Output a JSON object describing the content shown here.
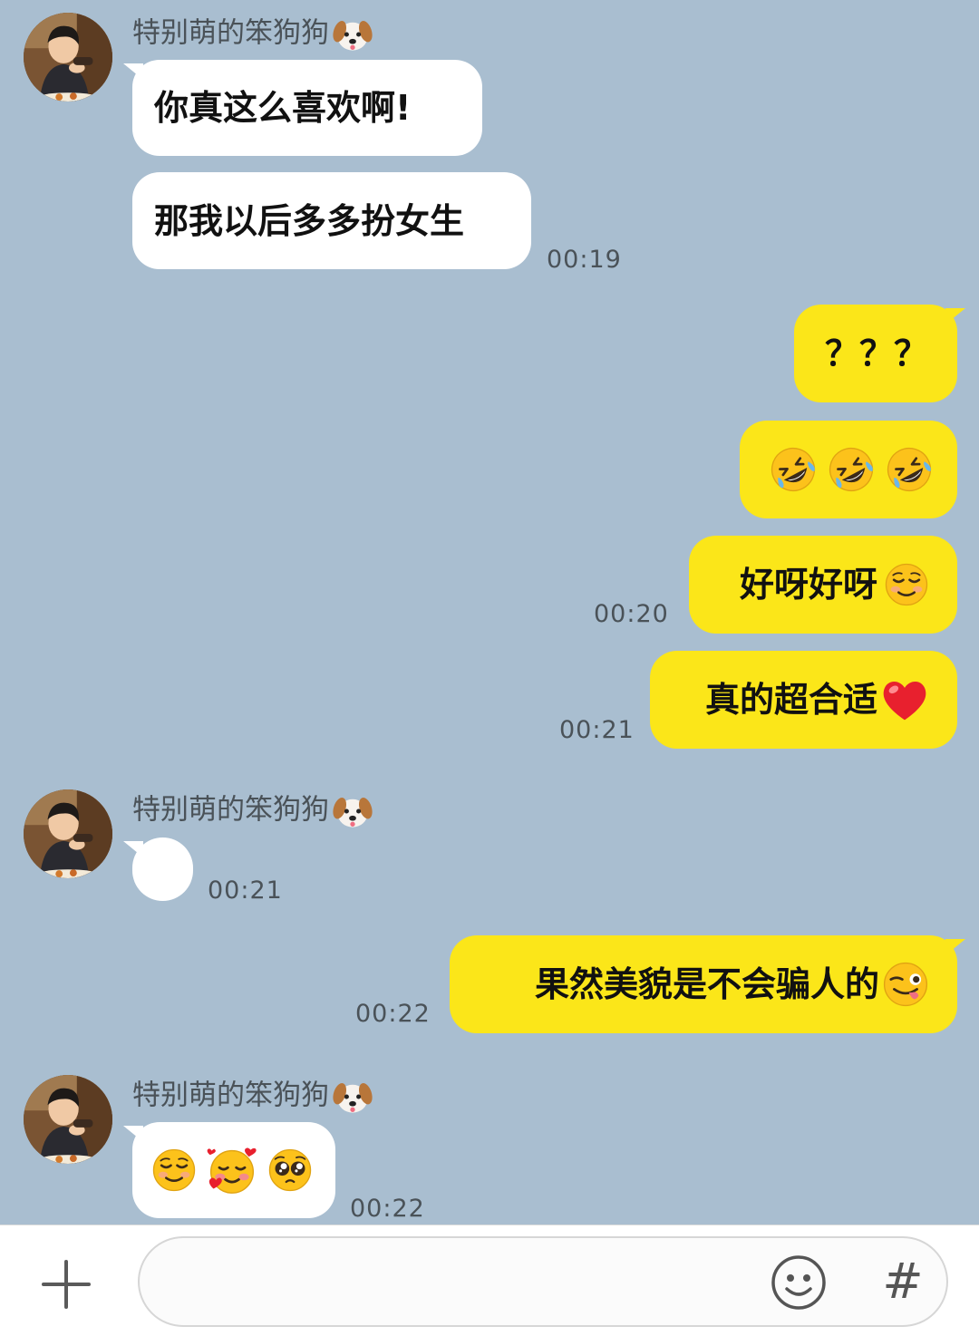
{
  "chat": {
    "contact_name": "特别萌的笨狗狗",
    "messages": {
      "m1": {
        "text": "你真这么喜欢啊!"
      },
      "m2": {
        "text": "那我以后多多扮女生",
        "time": "00:19"
      },
      "m3": {
        "text": "？？？"
      },
      "m4": {
        "emoji": [
          "rolling-on-floor-laughing",
          "rolling-on-floor-laughing",
          "rolling-on-floor-laughing"
        ]
      },
      "m5": {
        "text": "好呀好呀",
        "emoji": "smiling-face",
        "time": "00:20"
      },
      "m6": {
        "text": "真的超合适",
        "emoji": "red-heart",
        "time": "00:21"
      },
      "m7": {
        "content": "blank-bubble",
        "time": "00:21"
      },
      "m8": {
        "text": "果然美貌是不会骗人的",
        "emoji": "winking-tongue-face",
        "time": "00:22"
      },
      "m9": {
        "emoji": [
          "smiling-face",
          "smiling-face-with-hearts",
          "pleading-face"
        ],
        "time": "00:22"
      }
    }
  },
  "input_bar": {
    "placeholder": "",
    "plus_icon": "plus-icon",
    "emoji_icon": "smiley-icon",
    "hash_label": "#"
  },
  "colors": {
    "background": "#a9bed0",
    "outgoing_bubble": "#fbe619",
    "incoming_bubble": "#ffffff"
  }
}
